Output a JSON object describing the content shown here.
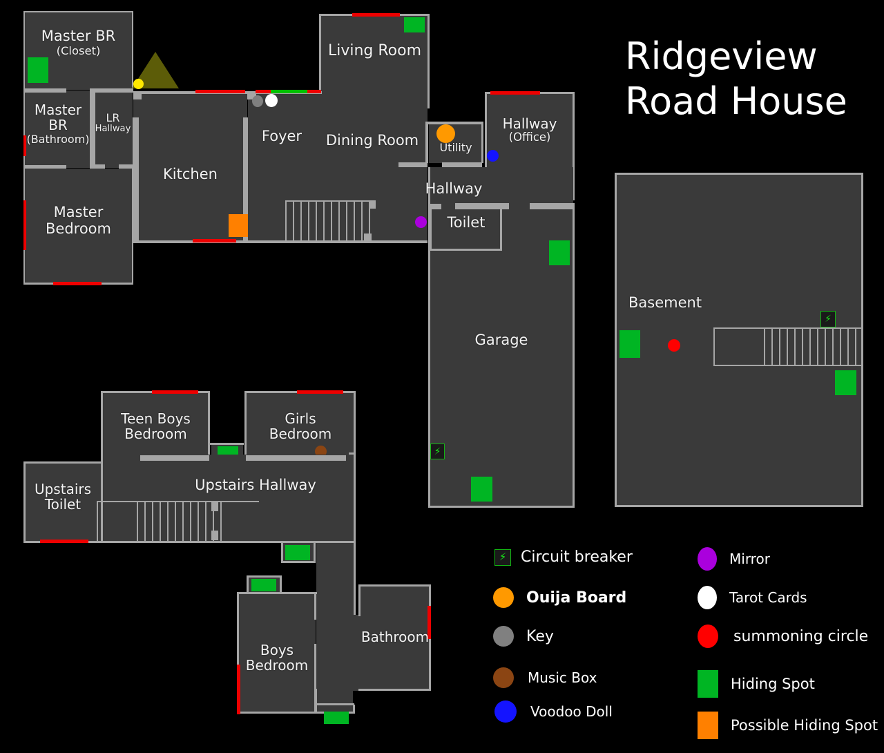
{
  "title": "Ridgeview\nRoad House",
  "rooms": {
    "master_br_closet": {
      "name": "Master BR",
      "sub": "(Closet)"
    },
    "master_br_bathroom": {
      "name": "Master\nBR",
      "sub": "(Bathroom)"
    },
    "master_bedroom": {
      "name": "Master\nBedroom"
    },
    "lr_hallway": {
      "name": "LR",
      "sub": "Hallway"
    },
    "kitchen": {
      "name": "Kitchen"
    },
    "living_room": {
      "name": "Living Room"
    },
    "foyer": {
      "name": "Foyer"
    },
    "dining_room": {
      "name": "Dining Room"
    },
    "utility": {
      "name": "Utility"
    },
    "hallway_office": {
      "name": "Hallway",
      "sub": "(Office)"
    },
    "hallway": {
      "name": "Hallway"
    },
    "toilet": {
      "name": "Toilet"
    },
    "garage": {
      "name": "Garage"
    },
    "basement": {
      "name": "Basement"
    },
    "teen_boys_bedroom": {
      "name": "Teen Boys\nBedroom"
    },
    "girls_bedroom": {
      "name": "Girls\nBedroom"
    },
    "upstairs_toilet": {
      "name": "Upstairs\nToilet"
    },
    "upstairs_hallway": {
      "name": "Upstairs Hallway"
    },
    "boys_bedroom": {
      "name": "Boys\nBedroom"
    },
    "bathroom": {
      "name": "Bathroom"
    }
  },
  "legend": {
    "left_column": [
      {
        "label": "Circuit breaker",
        "icon": "circuit-breaker-icon",
        "shape": "breaker",
        "color": "#19e219"
      },
      {
        "label": "Ouija Board",
        "icon": "ouija-board-icon",
        "shape": "circle",
        "color": "#ff9900"
      },
      {
        "label": "Key",
        "icon": "key-icon",
        "shape": "circle",
        "color": "#808080"
      },
      {
        "label": "Music Box",
        "icon": "music-box-icon",
        "shape": "circle",
        "color": "#8b4513"
      },
      {
        "label": "Voodoo Doll",
        "icon": "voodoo-doll-icon",
        "shape": "circle",
        "color": "#1414ff"
      }
    ],
    "right_column": [
      {
        "label": "Mirror",
        "icon": "mirror-icon",
        "shape": "circle",
        "color": "#aa00dd"
      },
      {
        "label": "Tarot Cards",
        "icon": "tarot-cards-icon",
        "shape": "circle",
        "color": "#ffffff"
      },
      {
        "label": "summoning circle",
        "icon": "summoning-circle-icon",
        "shape": "circle",
        "color": "#ff0000"
      },
      {
        "label": "Hiding Spot",
        "icon": "hiding-spot-icon",
        "shape": "square",
        "color": "#00b523"
      },
      {
        "label": "Possible Hiding Spot",
        "icon": "possible-hiding-spot-icon",
        "shape": "square",
        "color": "#ff8000"
      }
    ]
  },
  "markers": {
    "ouija_board": "Ouija Board",
    "key": "Key",
    "tarot_cards": "Tarot Cards",
    "mirror": "Mirror",
    "voodoo_doll": "Voodoo Doll",
    "music_box": "Music Box",
    "summoning_circle": "summoning circle",
    "yellow_dot": "Yellow Marker"
  },
  "colors": {
    "room_fill": "#3a3a3a",
    "wall": "#a6a6a6",
    "door": "#ee0000",
    "window": "#00c000",
    "hiding_spot": "#00b523",
    "possible_hiding_spot": "#ff8000",
    "background": "#000000",
    "text": "#ffffff"
  },
  "counts": {
    "hiding_spots": 11,
    "possible_hiding_spots": 1,
    "circuit_breakers": 2
  }
}
